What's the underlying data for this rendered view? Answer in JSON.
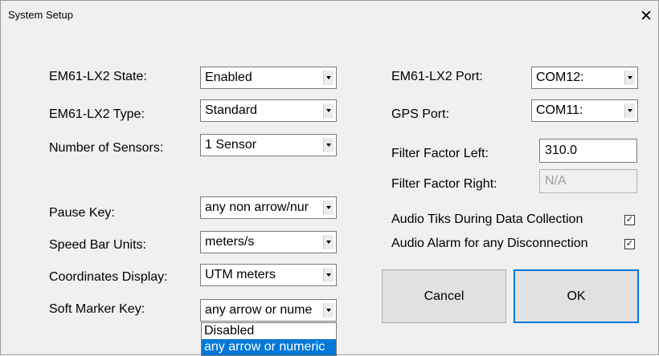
{
  "window": {
    "title": "System Setup",
    "close_glyph": "✕"
  },
  "left": {
    "state": {
      "label": "EM61-LX2 State:",
      "value": "Enabled"
    },
    "type": {
      "label": "EM61-LX2 Type:",
      "value": "Standard"
    },
    "sensors": {
      "label": "Number of Sensors:",
      "value": "1 Sensor"
    },
    "pause": {
      "label": "Pause Key:",
      "value": "any non arrow/nur"
    },
    "speed": {
      "label": "Speed Bar Units:",
      "value": "meters/s"
    },
    "coords": {
      "label": "Coordinates Display:",
      "value": "UTM meters"
    },
    "softmarker": {
      "label": "Soft Marker Key:",
      "value": "any arrow or nume"
    }
  },
  "right": {
    "port": {
      "label": "EM61-LX2 Port:",
      "value": "COM12:"
    },
    "gps": {
      "label": "GPS Port:",
      "value": "COM11:"
    },
    "filter_left": {
      "label": "Filter Factor Left:",
      "value": "310.0"
    },
    "filter_right": {
      "label": "Filter Factor Right:",
      "value": "N/A"
    },
    "audio_tiks": {
      "label": "Audio Tiks During Data Collection",
      "checked_glyph": "✓"
    },
    "audio_alarm": {
      "label": "Audio Alarm for any Disconnection",
      "checked_glyph": "✓"
    }
  },
  "buttons": {
    "cancel": "Cancel",
    "ok": "OK"
  },
  "dropdown_options": [
    "Disabled",
    "any arrow or numeric"
  ],
  "colors": {
    "accent": "#0078d7"
  }
}
